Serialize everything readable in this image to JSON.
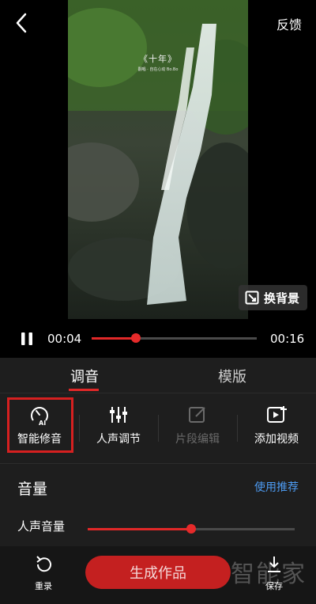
{
  "header": {
    "back_icon": "chevron-left-icon",
    "feedback_label": "反馈"
  },
  "video": {
    "lyric_title": "《十年》",
    "lyric_sub": "翻唱 · 自在心动 Bo.Bo",
    "swap_background_label": "换背景"
  },
  "player": {
    "current_time": "00:04",
    "total_time": "00:16",
    "progress": 0.27
  },
  "tabs": [
    {
      "label": "调音",
      "active": true
    },
    {
      "label": "模版",
      "active": false
    }
  ],
  "tools": [
    {
      "label": "智能修音",
      "icon": "ai-tune-icon",
      "enabled": true
    },
    {
      "label": "人声调节",
      "icon": "sliders-icon",
      "enabled": true
    },
    {
      "label": "片段编辑",
      "icon": "edit-icon",
      "enabled": false
    },
    {
      "label": "添加视频",
      "icon": "add-video-icon",
      "enabled": true
    }
  ],
  "volume": {
    "section_title": "音量",
    "recommend_label": "使用推荐",
    "vocal_label": "人声音量",
    "vocal_level": 0.5
  },
  "bottom": {
    "rerecord_label": "重录",
    "generate_label": "生成作品",
    "save_label": "保存",
    "watermark": "智能家"
  },
  "colors": {
    "accent": "#e02828",
    "link": "#4d9bf2",
    "panel": "#1e1e1e"
  }
}
